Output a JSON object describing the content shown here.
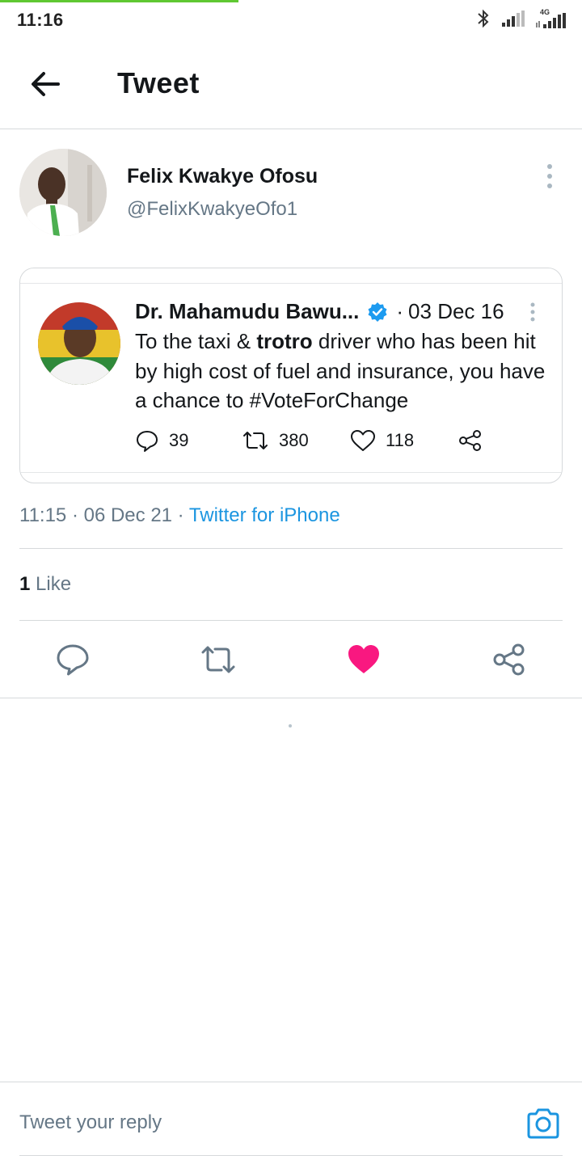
{
  "status_bar": {
    "time": "11:16",
    "network_label": "4G",
    "icons": [
      "bluetooth-icon",
      "signal-icon",
      "signal-4g-icon"
    ]
  },
  "header": {
    "title": "Tweet",
    "back_icon": "arrow-left-icon"
  },
  "tweet": {
    "author_name": "Felix Kwakye Ofosu",
    "author_handle": "@FelixKwakyeOfo1",
    "timestamp": "11:15 · 06 Dec 21",
    "separator": " · ",
    "source": "Twitter for iPhone",
    "likes_count": "1",
    "likes_label": "Like",
    "like_active": true
  },
  "quoted_tweet": {
    "author_name": "Dr. Mahamudu Bawu...",
    "verified": true,
    "separator": "·",
    "date": "03 Dec 16",
    "text_before": "To the taxi & ",
    "text_bold": "trotro",
    "text_after": " driver who has been hit by high cost of fuel and insurance, you have a chance to #VoteForChange",
    "replies": "39",
    "retweets": "380",
    "likes": "118"
  },
  "reply": {
    "placeholder": "Tweet your reply"
  },
  "colors": {
    "accent": "#1b95e0",
    "like": "#e0245e",
    "verified": "#1d9bf0",
    "progress": "#5fc832",
    "muted": "#657786"
  }
}
